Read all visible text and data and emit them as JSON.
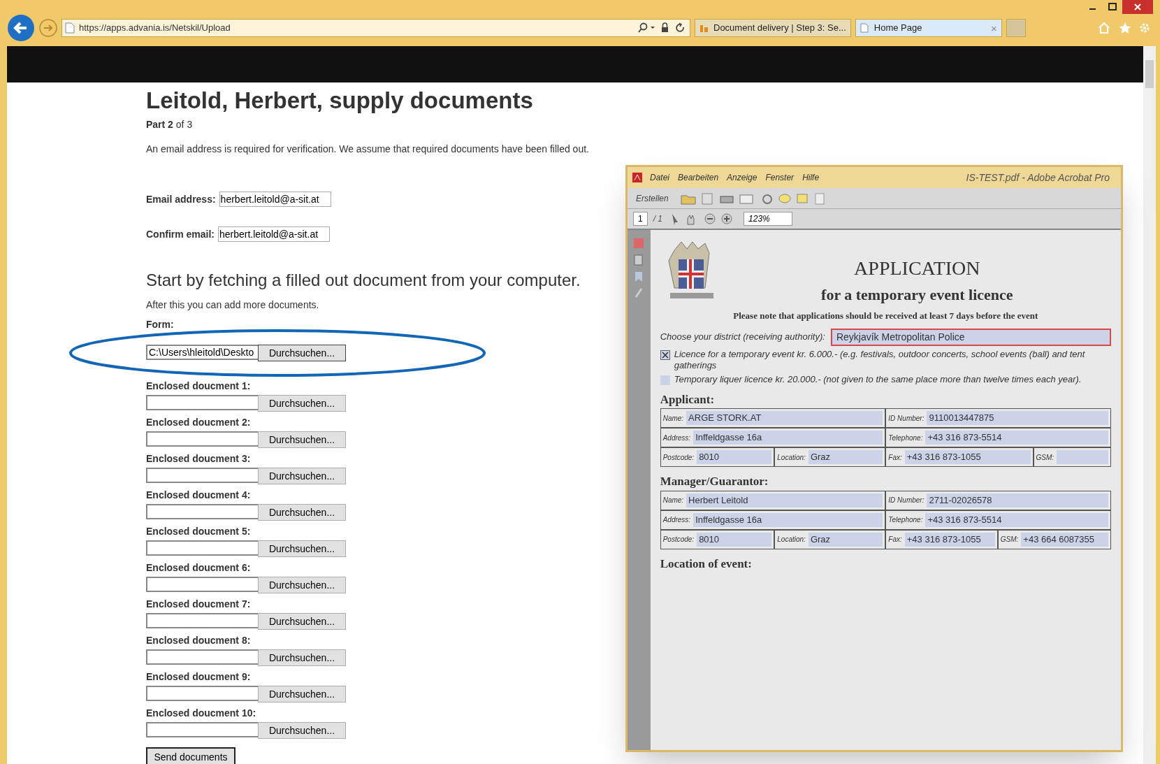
{
  "browser": {
    "url": "https://apps.advania.is/Netskil/Upload",
    "tabs": [
      {
        "title": "Document delivery | Step 3: Se...",
        "selected": false
      },
      {
        "title": "Home Page",
        "selected": true,
        "close": "×"
      }
    ]
  },
  "page": {
    "title": "Leitold, Herbert, supply documents",
    "part": "**Part 2** of 3",
    "intro": "An email address is required for verification. We assume that required documents have been filled out.",
    "email_fields": [
      {
        "label": "Email address:",
        "value": "herbert.leitold@a-sit.at"
      },
      {
        "label": "Confirm email:",
        "value": "herbert.leitold@a-sit.at"
      }
    ],
    "section_heading": "Start by fetching a filled out document from your computer.",
    "note": "After this you can add more documents.",
    "form": {
      "label": "Form:",
      "value": "C:\\Users\\hleitold\\Deskto",
      "button": "Durchsuchen..."
    },
    "enclosures": [
      {
        "label": "Enclosed doucment 1:",
        "button": "Durchsuchen..."
      },
      {
        "label": "Enclosed doucment 2:",
        "button": "Durchsuchen..."
      },
      {
        "label": "Enclosed doucment 3:",
        "button": "Durchsuchen..."
      },
      {
        "label": "Enclosed doucment 4:",
        "button": "Durchsuchen..."
      },
      {
        "label": "Enclosed doucment 5:",
        "button": "Durchsuchen..."
      },
      {
        "label": "Enclosed doucment 6:",
        "button": "Durchsuchen..."
      },
      {
        "label": "Enclosed doucment 7:",
        "button": "Durchsuchen..."
      },
      {
        "label": "Enclosed doucment 8:",
        "button": "Durchsuchen..."
      },
      {
        "label": "Enclosed doucment 9:",
        "button": "Durchsuchen..."
      },
      {
        "label": "Enclosed doucment 10:",
        "button": "Durchsuchen..."
      }
    ],
    "submit": "Send documents"
  },
  "acrobat": {
    "title": "IS-TEST.pdf - Adobe Acrobat Pro",
    "menu": [
      "Datei",
      "Bearbeiten",
      "Anzeige",
      "Fenster",
      "Hilfe"
    ],
    "create_button": "Erstellen",
    "page_number": "1",
    "page_total": "/ 1",
    "zoom": "123%",
    "document": {
      "heading": "APPLICATION",
      "subheading": "for a temporary event licence",
      "note": "Please note that applications should be received at least 7 days before the event",
      "district_prompt": "Choose your district (receiving authority):",
      "district": "Reykjavík Metropolitan Police",
      "options": [
        {
          "label": "Licence for a temporary event kr. 6.000.- (e.g. festivals, outdoor concerts, school events (ball) and tent gatherings",
          "checked": true
        },
        {
          "label": "Temporary liquer licence kr. 20.000.- (not given to the same place more than twelve times each year).",
          "checked": false
        }
      ],
      "sections": [
        {
          "heading": "Applicant:",
          "left": [
            [
              {
                "label": "Name:",
                "value": "ARGE STORK.AT"
              }
            ],
            [
              {
                "label": "Address:",
                "value": "Inffeldgasse 16a"
              }
            ],
            [
              {
                "label": "Postcode:",
                "value": "8010"
              },
              {
                "label": "Location:",
                "value": "Graz"
              }
            ]
          ],
          "right": [
            [
              {
                "label": "ID Number:",
                "value": "9110013447875"
              }
            ],
            [
              {
                "label": "Telephone:",
                "value": "+43 316 873-5514"
              }
            ],
            [
              {
                "label": "Fax:",
                "value": "+43 316 873-1055"
              },
              {
                "label": "GSM:"
              }
            ]
          ]
        },
        {
          "heading": "Manager/Guarantor:",
          "left": [
            [
              {
                "label": "Name:",
                "value": "Herbert Leitold"
              }
            ],
            [
              {
                "label": "Address:",
                "value": "Inffeldgasse 16a"
              }
            ],
            [
              {
                "label": "Postcode:",
                "value": "8010"
              },
              {
                "label": "Location:",
                "value": "Graz"
              }
            ]
          ],
          "right": [
            [
              {
                "label": "ID Number:",
                "value": "2711-02026578"
              }
            ],
            [
              {
                "label": "Telephone:",
                "value": "+43 316 873-5514"
              }
            ],
            [
              {
                "label": "Fax:",
                "value": "+43 316 873-1055"
              },
              {
                "label": "GSM:",
                "value": "+43 664 6087355"
              }
            ]
          ]
        }
      ],
      "location_heading": "Location of event:"
    }
  }
}
